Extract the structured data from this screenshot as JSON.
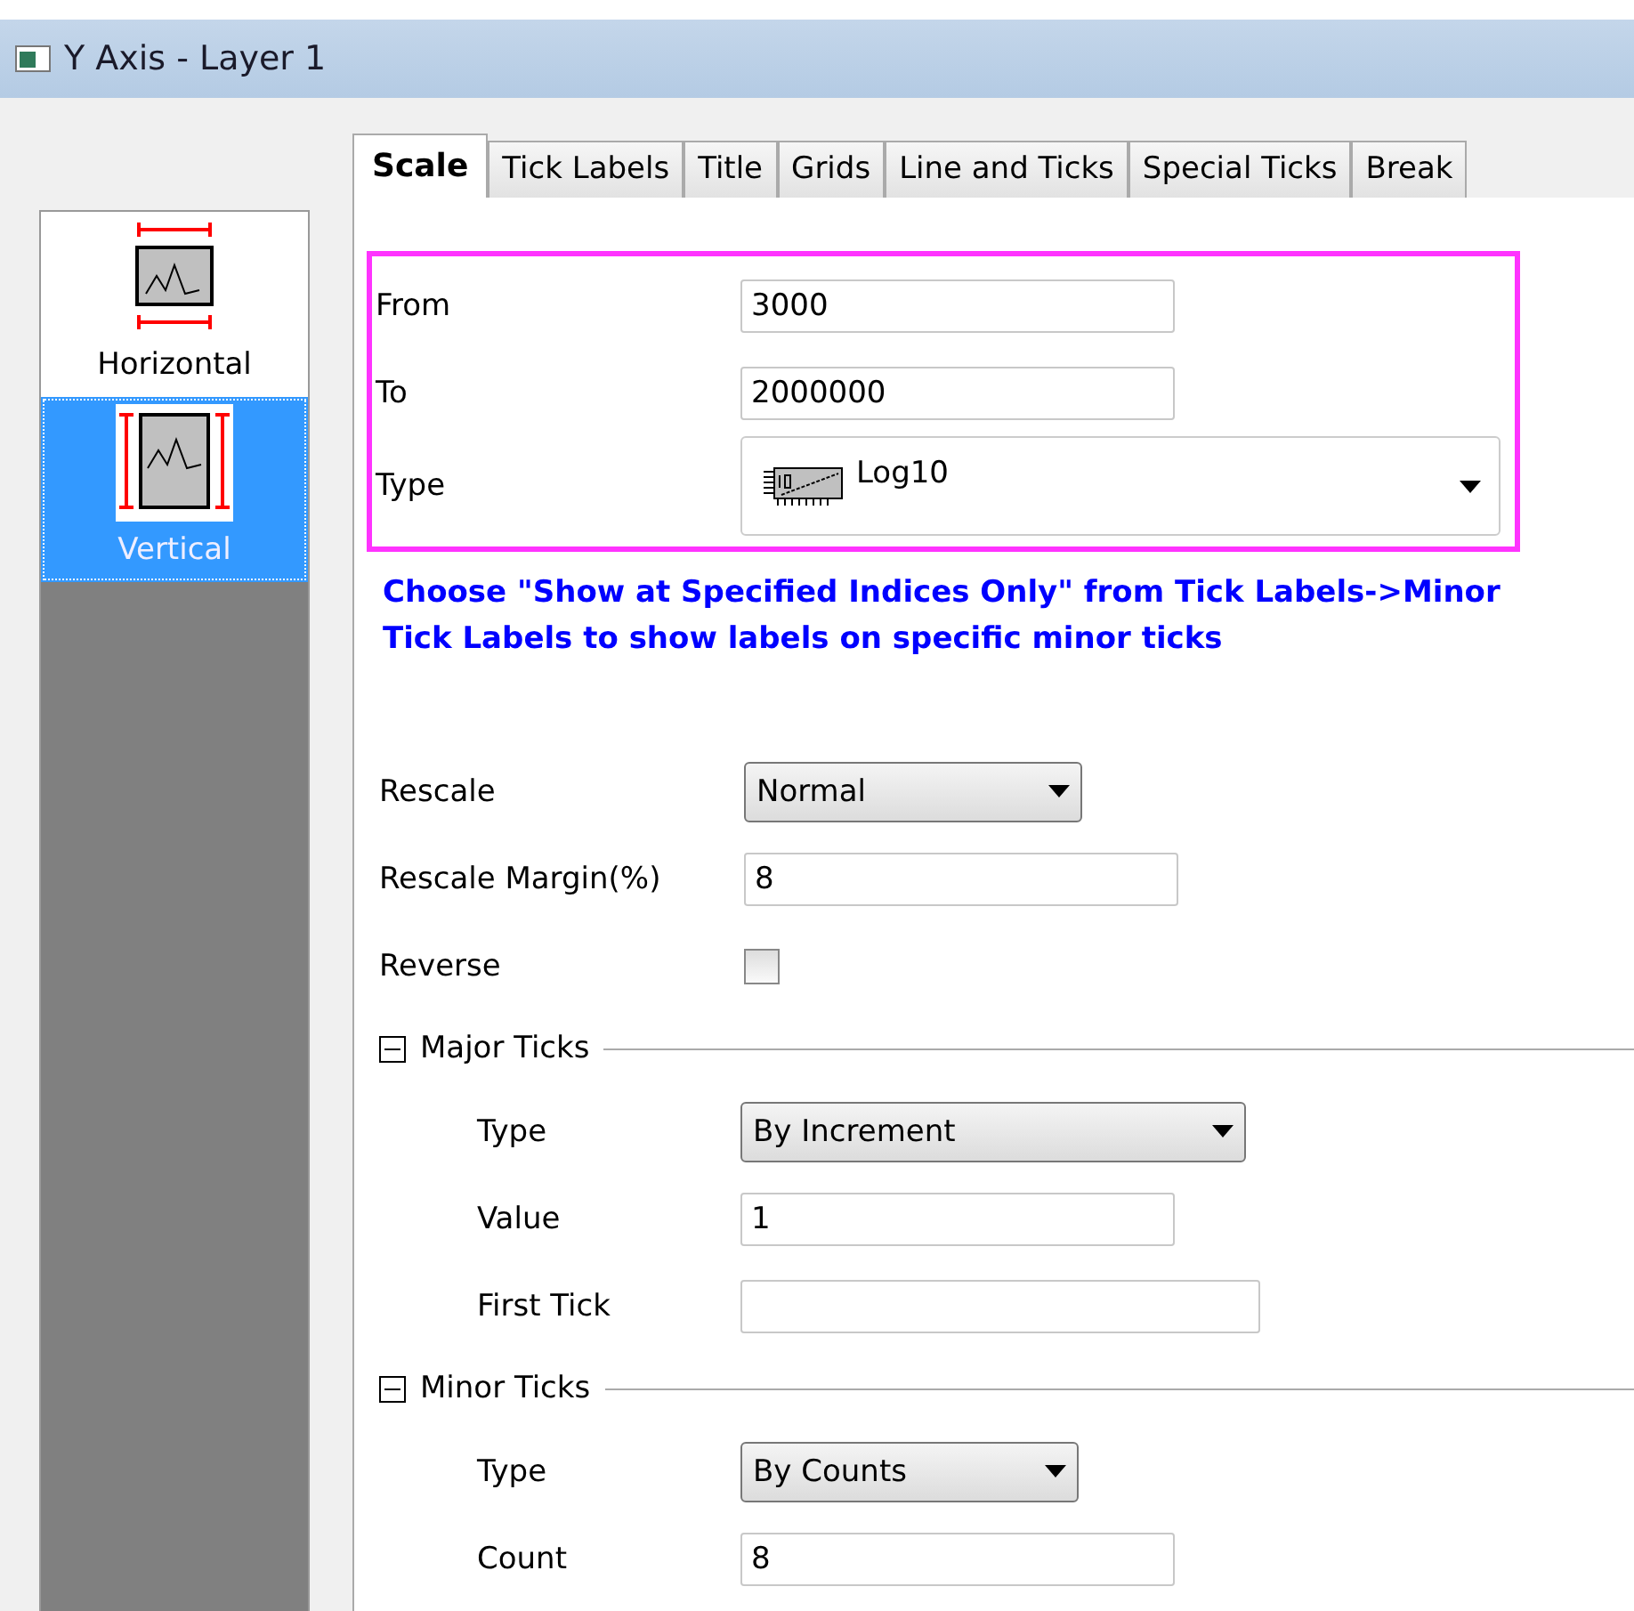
{
  "window": {
    "title": "Y Axis - Layer 1"
  },
  "sidebar": {
    "items": [
      {
        "label": "Horizontal",
        "kind": "horizontal",
        "selected": false
      },
      {
        "label": "Vertical",
        "kind": "vertical",
        "selected": true
      }
    ]
  },
  "tabs": [
    {
      "label": "Scale",
      "selected": true
    },
    {
      "label": "Tick Labels",
      "selected": false
    },
    {
      "label": "Title",
      "selected": false
    },
    {
      "label": "Grids",
      "selected": false
    },
    {
      "label": "Line and Ticks",
      "selected": false
    },
    {
      "label": "Special Ticks",
      "selected": false
    },
    {
      "label": "Break",
      "selected": false
    }
  ],
  "highlighted_fields": [
    {
      "label": "From",
      "kind": "text",
      "value": "3000"
    },
    {
      "label": "To",
      "kind": "text",
      "value": "2000000"
    },
    {
      "label": "Type",
      "kind": "icon-dropdown",
      "value": "Log10"
    }
  ],
  "note": "Choose \"Show at Specified Indices Only\" from Tick Labels->Minor Tick Labels to show labels on specific minor ticks",
  "fields": [
    {
      "label": "Rescale",
      "kind": "dropdown",
      "value": "Normal"
    },
    {
      "label": "Rescale Margin(%)",
      "kind": "text",
      "value": "8"
    },
    {
      "label": "Reverse",
      "kind": "checkbox",
      "checked": false
    }
  ],
  "groups": [
    {
      "title": "Major Ticks",
      "expanded": true,
      "fields": [
        {
          "label": "Type",
          "kind": "dropdown",
          "value": "By Increment"
        },
        {
          "label": "Value",
          "kind": "text",
          "value": "1"
        },
        {
          "label": "First Tick",
          "kind": "text"
        }
      ]
    },
    {
      "title": "Minor Ticks",
      "expanded": true,
      "fields": [
        {
          "label": "Type",
          "kind": "dropdown",
          "value": "By Counts"
        },
        {
          "label": "Count",
          "kind": "text",
          "value": "8"
        }
      ]
    }
  ]
}
